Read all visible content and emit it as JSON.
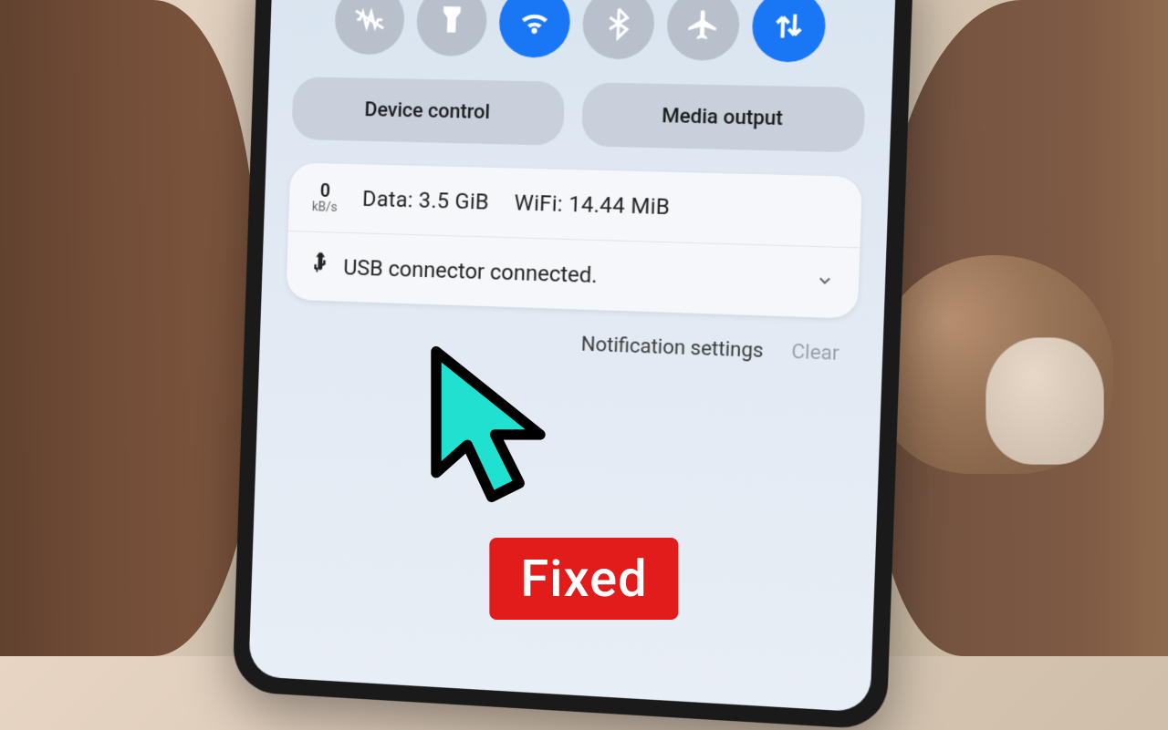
{
  "quick_settings": {
    "toggles": [
      {
        "name": "vibrate-icon",
        "active": false
      },
      {
        "name": "flashlight-icon",
        "active": false
      },
      {
        "name": "wifi-icon",
        "active": true
      },
      {
        "name": "bluetooth-icon",
        "active": false
      },
      {
        "name": "airplane-icon",
        "active": false
      },
      {
        "name": "data-transfer-icon",
        "active": true
      }
    ]
  },
  "pills": {
    "device_control": "Device control",
    "media_output": "Media output"
  },
  "data_card": {
    "speed_value": "0",
    "speed_unit": "kB/s",
    "data_label": "Data: 3.5 GiB",
    "wifi_label": "WiFi: 14.44 MiB"
  },
  "usb": {
    "message": "USB connector connected."
  },
  "actions": {
    "settings": "Notification settings",
    "clear": "Clear"
  },
  "overlay": {
    "badge": "Fixed",
    "cursor_color": "#20e0d0"
  }
}
